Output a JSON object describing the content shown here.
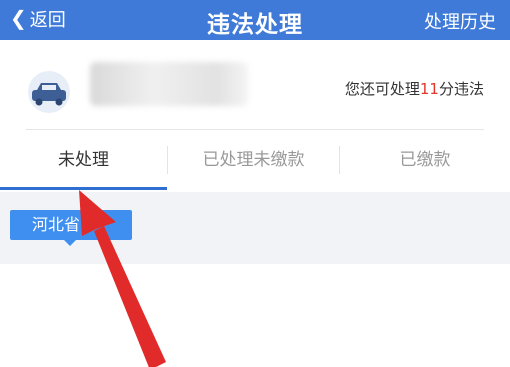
{
  "header": {
    "back_label": "返回",
    "title": "违法处理",
    "history_label": "处理历史"
  },
  "vehicle": {
    "remain_prefix": "您还可处理",
    "remain_points": "11",
    "remain_suffix": "分违法"
  },
  "tabs": [
    {
      "label": "未处理",
      "active": true
    },
    {
      "label": "已处理未缴款",
      "active": false
    },
    {
      "label": "已缴款",
      "active": false
    }
  ],
  "region": {
    "province": "河北省"
  },
  "colors": {
    "header_bg": "#3f7ad8",
    "accent": "#2f6fd1",
    "chip_bg": "#3f8ff0",
    "points_red": "#e2362c",
    "annotation_red": "#e12a2a"
  },
  "icons": {
    "back": "chevron-left-icon",
    "car": "car-icon",
    "annotation": "red-arrow-annotation"
  }
}
